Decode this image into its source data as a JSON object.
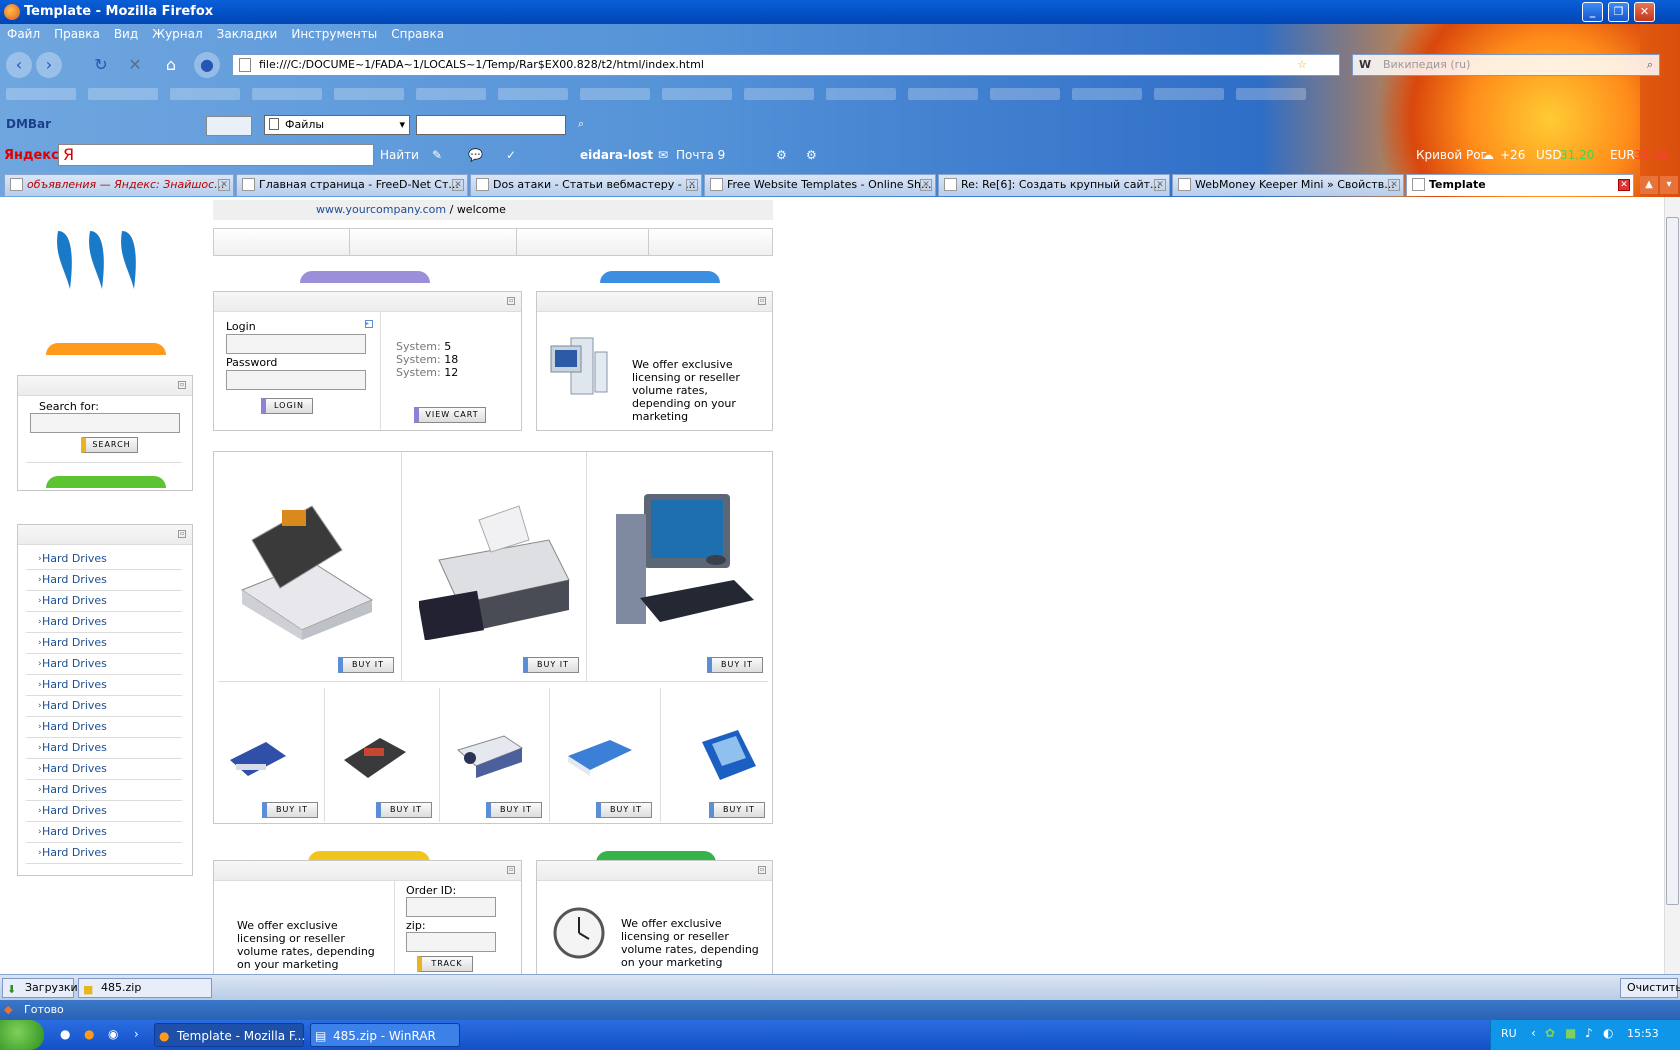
{
  "window": {
    "title": "Template - Mozilla Firefox"
  },
  "menu": [
    "Файл",
    "Правка",
    "Вид",
    "Журнал",
    "Закладки",
    "Инструменты",
    "Справка"
  ],
  "nav": {
    "url": "file:///C:/DOCUME~1/FADA~1/LOCALS~1/Temp/Rar$EX00.828/t2/html/index.html",
    "search_placeholder": "Википедия (ru)"
  },
  "dmbar": {
    "logo": "DMBar",
    "select_value": "Файлы"
  },
  "yandex": {
    "logo": "Яндекс",
    "input": "Я",
    "find": "Найти",
    "user": "eidara-lost",
    "mail": "Почта 9",
    "city": "Кривой Рог",
    "temp": "+26",
    "usd_label": "USD",
    "usd_value": "31,20",
    "eur_label": "EUR",
    "eur_value": "38,19"
  },
  "tabs": [
    {
      "label": "объявления — Яндекс: Знайшос..."
    },
    {
      "label": "Главная страница - FreeD-Net Ст..."
    },
    {
      "label": "Dos атаки - Статьи вебмастеру - ..."
    },
    {
      "label": "Free Website Templates - Online Sh..."
    },
    {
      "label": "Re: Re[6]: Создать крупный сайт..."
    },
    {
      "label": "WebMoney Keeper Mini » Свойств..."
    },
    {
      "label": "Template"
    }
  ],
  "page": {
    "breadcrumb_link": "www.yourcompany.com",
    "breadcrumb_sep": "/",
    "breadcrumb_current": "welcome",
    "login": {
      "login_label": "Login",
      "password_label": "Password",
      "login_button": "LOGIN",
      "system_label": "System:",
      "system_values": [
        "5",
        "18",
        "12"
      ],
      "view_cart_button": "VIEW CART"
    },
    "offer_text": "We offer exclusive licensing or reseller volume rates, depending on your marketing",
    "search": {
      "label": "Search for:",
      "button": "SEARCH"
    },
    "categories": [
      "Hard Drives",
      "Hard Drives",
      "Hard Drives",
      "Hard Drives",
      "Hard Drives",
      "Hard Drives",
      "Hard Drives",
      "Hard Drives",
      "Hard Drives",
      "Hard Drives",
      "Hard Drives",
      "Hard Drives",
      "Hard Drives",
      "Hard Drives",
      "Hard Drives"
    ],
    "buy_button": "BUY IT",
    "track": {
      "text": "We offer exclusive licensing or reseller volume rates, depending on your marketing",
      "order_label": "Order ID:",
      "zip_label": "zip:",
      "button": "TRACK"
    },
    "clock_text": "We offer exclusive licensing or reseller volume rates, depending on your marketing"
  },
  "downloads": {
    "label": "Загрузки",
    "file": "485.zip",
    "clear": "Очистить"
  },
  "status": {
    "text": "Готово"
  },
  "taskbar": {
    "tasks": [
      "Template - Mozilla F...",
      "485.zip - WinRAR"
    ],
    "lang": "RU",
    "clock": "15:53"
  },
  "colors": {
    "accent": "#1d4f92",
    "titlebar": "#0a5fd8"
  }
}
